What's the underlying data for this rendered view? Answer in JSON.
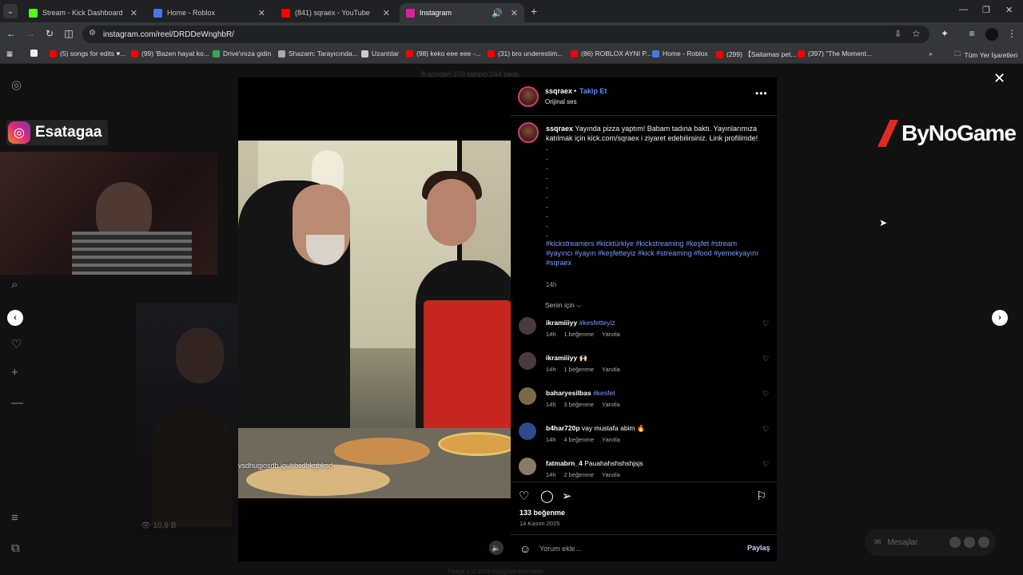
{
  "browser": {
    "tabs": [
      {
        "title": "Stream - Kick Dashboard",
        "favicon_color": "#53fc18"
      },
      {
        "title": "Home - Roblox",
        "favicon_color": "#4a74e8"
      },
      {
        "title": "(841) sqraex - YouTube",
        "favicon_color": "#ff0000"
      },
      {
        "title": "Instagram",
        "favicon_color": "#d6249f"
      }
    ],
    "url": "instagram.com/reel/DRDDeWnghbR/",
    "bookmarks": [
      {
        "label": "(5) songs for edits ♥...",
        "color": "#ff0000"
      },
      {
        "label": "(99) 'Bazen hayat ko...",
        "color": "#ff0000"
      },
      {
        "label": "Drive'ınıza gidin",
        "color": "#34a853"
      },
      {
        "label": "Shazam: Tarayıcında...",
        "color": "#aaaaaa"
      },
      {
        "label": "Uzantılar",
        "color": "#cccccc"
      },
      {
        "label": "(98) keko eee eee -...",
        "color": "#ff0000"
      },
      {
        "label": "(31) bro underestim...",
        "color": "#ff0000"
      },
      {
        "label": "(86) ROBLOX AYNI P...",
        "color": "#ff0000"
      },
      {
        "label": "Home - Roblox",
        "color": "#4a74e8"
      },
      {
        "label": "(299) 【Saitamas pet...",
        "color": "#ff0000"
      },
      {
        "label": "(397) \"The Moment...",
        "color": "#ff0000"
      }
    ],
    "all_bookmarks": "Tüm Yer İşaretleri"
  },
  "background": {
    "streamer_tag": "Esatagaa",
    "sponsor": "ByNoGame",
    "stats": "8 gönderi   270 takipçi   244 takip",
    "views": "10,9 B",
    "messages_label": "Mesajlar",
    "footer": "Türkçe  ∨   © 2025 Instagram from Meta"
  },
  "post": {
    "username": "ssqraex",
    "follow": "Takip Et",
    "audio": "Orijinal ses",
    "caption": "Yayında pizza yaptım! Babam tadına baktı. Yayınlarımıza katılmak için kick.com/sqraex i ziyaret edebilirsiniz. Link profilimde!",
    "hashtags": "#kickstreamers #kicktürkiye #kickstreaming #keşfet #stream #yayıncı #yayın #keşfetteyiz #kick #streaming #food #yemekyayını #sqraex",
    "caption_time": "14h",
    "sort_label": "Senin için",
    "video_watermark": "vsdhugjosdb jguhbsdhkgbksd",
    "likes": "133 beğenme",
    "date": "14 Kasım 2025",
    "comment_placeholder": "Yorum ekle...",
    "share_label": "Paylaş",
    "comments": [
      {
        "user": "ikramiiiyy",
        "text": "#kesfetteyiz",
        "is_tag": true,
        "time": "14h",
        "likes": "1 beğenme",
        "reply": "Yanıtla",
        "avatar_color": "#4a3a40"
      },
      {
        "user": "ikramiiiyy",
        "text": "🙌🏻",
        "is_tag": false,
        "time": "14h",
        "likes": "1 beğenme",
        "reply": "Yanıtla",
        "avatar_color": "#4a3a40"
      },
      {
        "user": "baharyesilbas",
        "text": "#kesfet",
        "is_tag": true,
        "time": "14h",
        "likes": "3 beğenme",
        "reply": "Yanıtla",
        "avatar_color": "#7a6a4a"
      },
      {
        "user": "b4har720p",
        "text": "vay mustafa abim 🔥",
        "is_tag": false,
        "time": "14h",
        "likes": "4 beğenme",
        "reply": "Yanıtla",
        "avatar_color": "#2c4c8c"
      },
      {
        "user": "fatmabrn_4",
        "text": "Pauahahshshshjsjs",
        "is_tag": false,
        "time": "14h",
        "likes": "2 beğenme",
        "reply": "Yanıtla",
        "avatar_color": "#8a7a6a"
      }
    ]
  }
}
